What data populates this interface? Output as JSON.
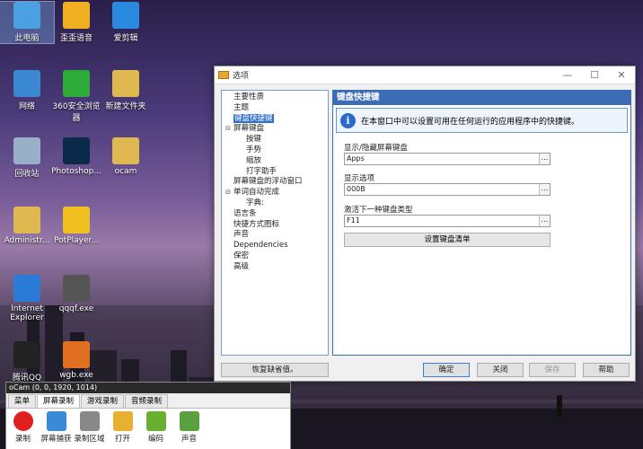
{
  "desktop": {
    "icons": [
      {
        "label": "此电脑",
        "icon": "computer-icon",
        "color": "#4aa0e0"
      },
      {
        "label": "歪歪语音",
        "icon": "yy-icon",
        "color": "#f0b020"
      },
      {
        "label": "爱剪辑",
        "icon": "aijianji-icon",
        "color": "#2a8ae0"
      },
      {
        "label": "网络",
        "icon": "network-icon",
        "color": "#3a88d0"
      },
      {
        "label": "360安全浏览器",
        "icon": "360-browser-icon",
        "color": "#2eaa3a"
      },
      {
        "label": "新建文件夹",
        "icon": "folder-icon",
        "color": "#e0b850"
      },
      {
        "label": "回收站",
        "icon": "recycle-bin-icon",
        "color": "#9ab0c8"
      },
      {
        "label": "Photoshop...",
        "icon": "photoshop-icon",
        "color": "#0a2a4a"
      },
      {
        "label": "ocam",
        "icon": "folder-icon",
        "color": "#e0b850"
      },
      {
        "label": "Administr...",
        "icon": "user-folder-icon",
        "color": "#e0b850"
      },
      {
        "label": "PotPlayer...",
        "icon": "potplayer-icon",
        "color": "#f0c020"
      },
      {
        "label": "Internet Explorer",
        "icon": "ie-icon",
        "color": "#2a7ad8"
      },
      {
        "label": "qqqf.exe",
        "icon": "qqqf-icon",
        "color": "#555"
      },
      {
        "label": "腾讯QQ",
        "icon": "qq-icon",
        "color": "#222"
      },
      {
        "label": "wgb.exe",
        "icon": "wgb-icon",
        "color": "#e07020"
      }
    ]
  },
  "dialog": {
    "title": "选项",
    "tree": [
      {
        "label": "主要性质",
        "indent": 0,
        "exp": ""
      },
      {
        "label": "主题",
        "indent": 0,
        "exp": ""
      },
      {
        "label": "键盘快捷键",
        "indent": 0,
        "exp": "",
        "selected": true
      },
      {
        "label": "屏幕键盘",
        "indent": 0,
        "exp": "⊟"
      },
      {
        "label": "按键",
        "indent": 2,
        "exp": ""
      },
      {
        "label": "手势",
        "indent": 2,
        "exp": ""
      },
      {
        "label": "缩放",
        "indent": 2,
        "exp": ""
      },
      {
        "label": "打字助手",
        "indent": 2,
        "exp": ""
      },
      {
        "label": "屏幕键盘的浮动窗口",
        "indent": 0,
        "exp": ""
      },
      {
        "label": "单词自动完成",
        "indent": 0,
        "exp": "⊟"
      },
      {
        "label": "字典:",
        "indent": 2,
        "exp": ""
      },
      {
        "label": "语言条",
        "indent": 0,
        "exp": ""
      },
      {
        "label": "快捷方式图标",
        "indent": 0,
        "exp": ""
      },
      {
        "label": "声音",
        "indent": 0,
        "exp": ""
      },
      {
        "label": "Dependencies",
        "indent": 0,
        "exp": ""
      },
      {
        "label": "保密",
        "indent": 0,
        "exp": ""
      },
      {
        "label": "高级",
        "indent": 0,
        "exp": ""
      }
    ],
    "panel": {
      "heading": "键盘快捷键",
      "info": "在本窗口中可以设置可用在任何运行的应用程序中的快捷键。",
      "fields": [
        {
          "label": "显示/隐藏屏幕键盘",
          "value": "Apps"
        },
        {
          "label": "显示选项",
          "value": "000B"
        },
        {
          "label": "激活下一种键盘类型",
          "value": "F11"
        }
      ],
      "keyboard_list_button": "设置键盘清单"
    },
    "restore_defaults": "恢复缺省值。",
    "ok": "确定",
    "close": "关闭",
    "save": "保存",
    "help": "帮助"
  },
  "ocam": {
    "title": "oCam (0, 0, 1920, 1014)",
    "tabs": [
      "菜单",
      "屏幕录制",
      "游戏录制",
      "音频录制"
    ],
    "active_tab": 1,
    "tools": [
      {
        "label": "录制",
        "icon": "record-icon",
        "color": "#e02020"
      },
      {
        "label": "屏幕捕获",
        "icon": "screen-capture-icon",
        "color": "#3a8ad8"
      },
      {
        "label": "录制区域",
        "icon": "record-area-icon",
        "color": "#888"
      },
      {
        "label": "打开",
        "icon": "open-folder-icon",
        "color": "#e8b030"
      },
      {
        "label": "编码",
        "icon": "codec-icon",
        "color": "#6ab030"
      },
      {
        "label": "声音",
        "icon": "microphone-icon",
        "color": "#5aa040"
      }
    ]
  }
}
